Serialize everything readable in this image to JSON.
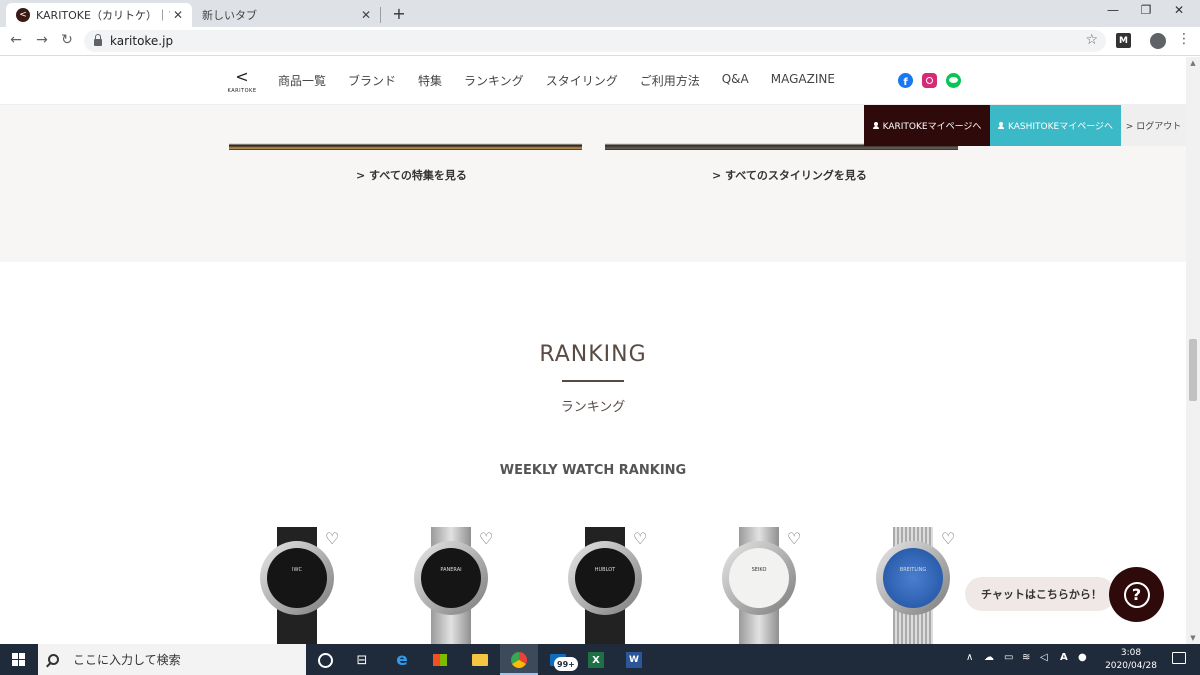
{
  "browser": {
    "tabs": [
      {
        "title": "KARITOKE（カリトケ）｜ブランド腕時"
      },
      {
        "title": "新しいタブ"
      }
    ],
    "close_glyph": "✕",
    "new_tab_glyph": "+",
    "window_controls": {
      "minimize": "—",
      "maximize": "❐",
      "close": "✕"
    },
    "nav": {
      "back": "←",
      "forward": "→",
      "reload": "↻"
    },
    "url": "karitoke.jp",
    "star_glyph": "☆",
    "extension_label": "M",
    "menu_glyph": "⋮",
    "favicon_glyph": "<"
  },
  "site": {
    "logo_mark": "<",
    "logo_text": "KARITOKE",
    "menu": [
      "商品一覧",
      "ブランド",
      "特集",
      "ランキング",
      "スタイリング",
      "ご利用方法",
      "Q&A",
      "MAGAZINE"
    ],
    "social_icons": [
      "facebook-icon",
      "instagram-icon",
      "line-icon"
    ],
    "facebook_glyph": "f",
    "colors": {
      "brand": "#2f0a0a",
      "kashitoke": "#3cb9c7",
      "band": "#f7f6f5"
    }
  },
  "mypage": {
    "karitoke": "KARITOKEマイページへ",
    "kashitoke": "KASHITOKEマイページへ",
    "logout": "> ログアウト"
  },
  "features": {
    "see_all_features": "> すべての特集を見る",
    "see_all_styling": "> すべてのスタイリングを見る"
  },
  "ranking": {
    "title": "RANKING",
    "subtitle": "ランキング",
    "weekly": "WEEKLY WATCH RANKING",
    "heart_glyph": "♡",
    "watches": [
      {
        "brand_mark": "IWC",
        "dial": "black",
        "strap": "leather"
      },
      {
        "brand_mark": "PANERAI",
        "dial": "black",
        "strap": "metal"
      },
      {
        "brand_mark": "HUBLOT",
        "dial": "black",
        "strap": "leather"
      },
      {
        "brand_mark": "SEIKO",
        "dial": "white",
        "strap": "metal"
      },
      {
        "brand_mark": "BREITLING",
        "dial": "blue",
        "strap": "mesh"
      }
    ]
  },
  "chat": {
    "label": "チャットはこちらから！",
    "button_glyph": "?"
  },
  "scrollbar": {
    "up": "▲",
    "down": "▼"
  },
  "taskbar": {
    "search_placeholder": "ここに入力して検索",
    "taskview_glyph": "⊟",
    "edge_glyph": "e",
    "mail_badge": "99+",
    "tray": {
      "chevron": "∧",
      "ime": "A"
    },
    "time": "3:08",
    "date": "2020/04/28"
  }
}
